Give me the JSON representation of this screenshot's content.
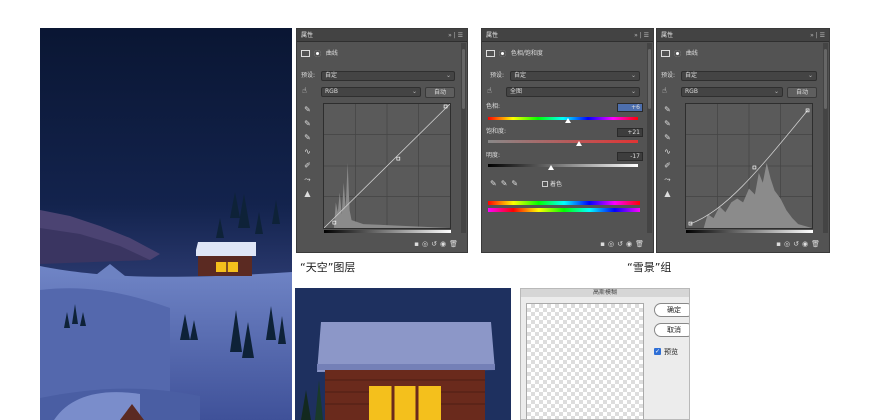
{
  "panels": {
    "curves1": {
      "title": "属性",
      "controls": "»  |  ☰",
      "adj_name": "曲线",
      "preset_label": "预设:",
      "preset_value": "自定",
      "channel": "RGB",
      "auto_label": "自动"
    },
    "huesat": {
      "title": "属性",
      "controls": "»  |  ☰",
      "adj_name": "色相/饱和度",
      "preset_label": "预设:",
      "preset_value": "自定",
      "range": "全图",
      "hue_label": "色相:",
      "hue_value": "+6",
      "sat_label": "饱和度:",
      "sat_value": "+21",
      "light_label": "明度:",
      "light_value": "-17",
      "colorize_label": "着色"
    },
    "curves2": {
      "title": "属性",
      "controls": "»  |  ☰",
      "adj_name": "曲线",
      "preset_label": "预设:",
      "preset_value": "自定",
      "channel": "RGB",
      "auto_label": "自动"
    }
  },
  "captions": {
    "sky_layer": "“天空”图层",
    "snow_group": "“雪景”组"
  },
  "blur_dialog": {
    "title": "高斯模糊",
    "ok_label": "确定",
    "cancel_label": "取消",
    "preview_label": "预览"
  },
  "colors": {
    "panel_bg": "#535353",
    "title_bg": "#434343",
    "sky_top": "#0b1a3f",
    "snow": "#5d73b8",
    "window_light": "#f4c01c"
  }
}
